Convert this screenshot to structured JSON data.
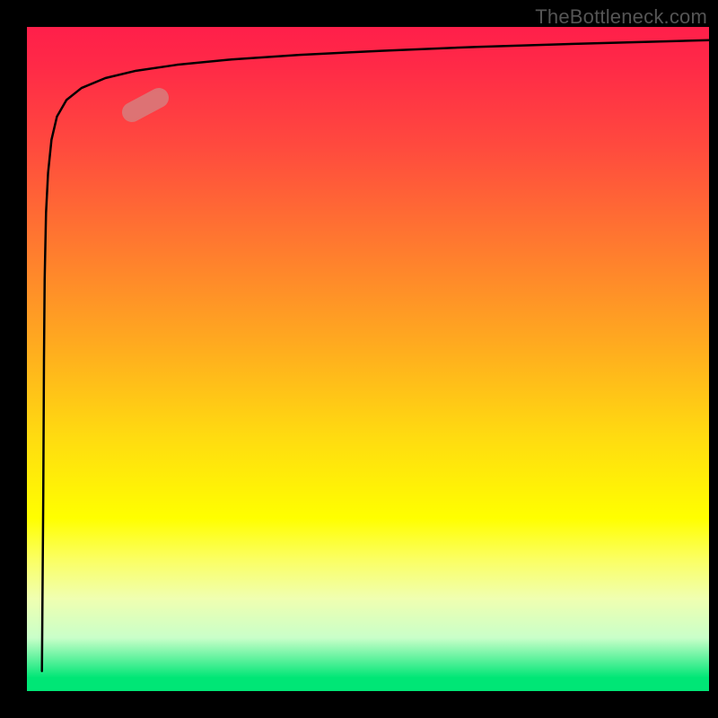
{
  "watermark": "TheBottleneck.com",
  "chart_data": {
    "type": "line",
    "title": "",
    "xlabel": "",
    "ylabel": "",
    "xlim": [
      0,
      100
    ],
    "ylim": [
      0,
      100
    ],
    "background_gradient": {
      "top": "#ff1f4a",
      "middle": "#ffff00",
      "bottom": "#00e676"
    },
    "series": [
      {
        "name": "curve",
        "x": [
          2.2,
          2.4,
          2.5,
          2.6,
          2.8,
          3.1,
          3.6,
          4.4,
          5.8,
          8.0,
          11.5,
          16.0,
          22.0,
          30.0,
          40.0,
          52.0,
          66.0,
          82.0,
          100.0
        ],
        "y": [
          3.0,
          30.0,
          50.0,
          62.0,
          72.0,
          78.0,
          83.0,
          86.5,
          89.0,
          90.8,
          92.3,
          93.4,
          94.3,
          95.1,
          95.8,
          96.4,
          97.0,
          97.5,
          98.0
        ]
      }
    ],
    "marker": {
      "x": 17.4,
      "y": 88.3,
      "rotation_deg": -28,
      "color": "#d77d7d"
    }
  }
}
